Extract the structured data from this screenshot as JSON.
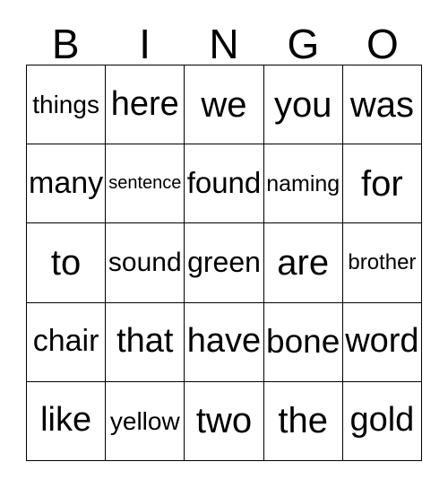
{
  "card": {
    "columns": [
      "B",
      "I",
      "N",
      "G",
      "O"
    ],
    "rows": [
      [
        "things",
        "here",
        "we",
        "you",
        "was"
      ],
      [
        "many",
        "sentence",
        "found",
        "naming",
        "for"
      ],
      [
        "to",
        "sound",
        "green",
        "are",
        "brother"
      ],
      [
        "chair",
        "that",
        "have",
        "bone",
        "word"
      ],
      [
        "like",
        "yellow",
        "two",
        "the",
        "gold"
      ]
    ],
    "colors": {
      "background": "#ffffff",
      "grid_line": "#000000",
      "text": "#000000"
    }
  }
}
